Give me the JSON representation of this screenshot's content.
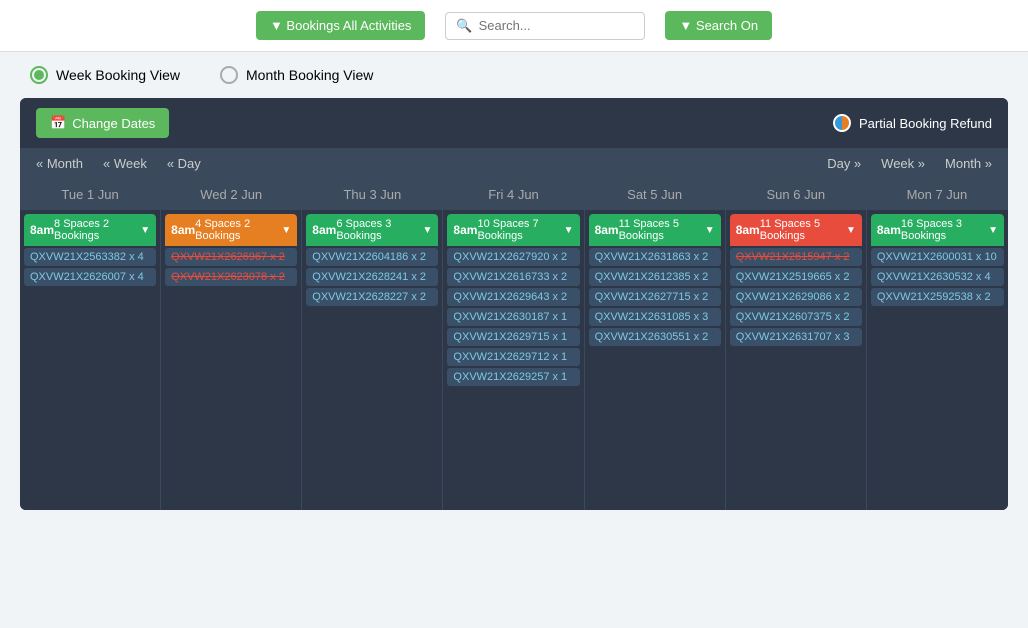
{
  "header": {
    "bookings_button": "▼ Bookings All Activities",
    "search_placeholder": "Search...",
    "search_on_button": "▼ Search On"
  },
  "view_selector": {
    "week_label": "Week Booking View",
    "month_label": "Month Booking View",
    "active": "week"
  },
  "calendar": {
    "change_dates_label": "Change Dates",
    "calendar_icon": "📅",
    "partial_booking_label": "Partial Booking Refund",
    "nav": {
      "month_prev": "« Month",
      "week_prev": "« Week",
      "day_prev": "« Day",
      "day_next": "Day »",
      "week_next": "Week »",
      "month_next": "Month »"
    },
    "days": [
      {
        "label": "Tue 1 Jun",
        "slots": [
          {
            "time": "8am",
            "spaces": "8 Spaces 2 Bookings",
            "color": "green",
            "bookings": [
              {
                "id": "QXVW21X2563382 x 4",
                "strike": false
              },
              {
                "id": "QXVW21X2626007 x 4",
                "strike": false
              }
            ]
          }
        ]
      },
      {
        "label": "Wed 2 Jun",
        "slots": [
          {
            "time": "8am",
            "spaces": "4 Spaces 2 Bookings",
            "color": "orange",
            "bookings": [
              {
                "id": "QXVW21X2626967 x 2",
                "strike": true
              },
              {
                "id": "QXVW21X2623078 x 2",
                "strike": true
              }
            ]
          }
        ]
      },
      {
        "label": "Thu 3 Jun",
        "slots": [
          {
            "time": "8am",
            "spaces": "6 Spaces 3 Bookings",
            "color": "green",
            "bookings": [
              {
                "id": "QXVW21X2604186 x 2",
                "strike": false
              },
              {
                "id": "QXVW21X2628241 x 2",
                "strike": false
              },
              {
                "id": "QXVW21X2628227 x 2",
                "strike": false
              }
            ]
          }
        ]
      },
      {
        "label": "Fri 4 Jun",
        "slots": [
          {
            "time": "8am",
            "spaces": "10 Spaces 7 Bookings",
            "color": "green",
            "bookings": [
              {
                "id": "QXVW21X2627920 x 2",
                "strike": false
              },
              {
                "id": "QXVW21X2616733 x 2",
                "strike": false
              },
              {
                "id": "QXVW21X2629643 x 2",
                "strike": false
              },
              {
                "id": "QXVW21X2630187 x 1",
                "strike": false
              },
              {
                "id": "QXVW21X2629715 x 1",
                "strike": false
              },
              {
                "id": "QXVW21X2629712 x 1",
                "strike": false
              },
              {
                "id": "QXVW21X2629257 x 1",
                "strike": false
              }
            ]
          }
        ]
      },
      {
        "label": "Sat 5 Jun",
        "slots": [
          {
            "time": "8am",
            "spaces": "11 Spaces 5 Bookings",
            "color": "green",
            "bookings": [
              {
                "id": "QXVW21X2631863 x 2",
                "strike": false
              },
              {
                "id": "QXVW21X2612385 x 2",
                "strike": false
              },
              {
                "id": "QXVW21X2627715 x 2",
                "strike": false
              },
              {
                "id": "QXVW21X2631085 x 3",
                "strike": false
              },
              {
                "id": "QXVW21X2630551 x 2",
                "strike": false
              }
            ]
          }
        ]
      },
      {
        "label": "Sun 6 Jun",
        "slots": [
          {
            "time": "8am",
            "spaces": "11 Spaces 5 Bookings",
            "color": "red",
            "bookings": [
              {
                "id": "QXVW21X2615947 x 2",
                "strike": true
              },
              {
                "id": "QXVW21X2519665 x 2",
                "strike": false
              },
              {
                "id": "QXVW21X2629086 x 2",
                "strike": false
              },
              {
                "id": "QXVW21X2607375 x 2",
                "strike": false
              },
              {
                "id": "QXVW21X2631707 x 3",
                "strike": false
              }
            ]
          }
        ]
      },
      {
        "label": "Mon 7 Jun",
        "slots": [
          {
            "time": "8am",
            "spaces": "16 Spaces 3 Bookings",
            "color": "green",
            "bookings": [
              {
                "id": "QXVW21X2600031 x 10",
                "strike": false
              },
              {
                "id": "QXVW21X2630532 x 4",
                "strike": false
              },
              {
                "id": "QXVW21X2592538 x 2",
                "strike": false
              }
            ]
          }
        ]
      }
    ]
  }
}
